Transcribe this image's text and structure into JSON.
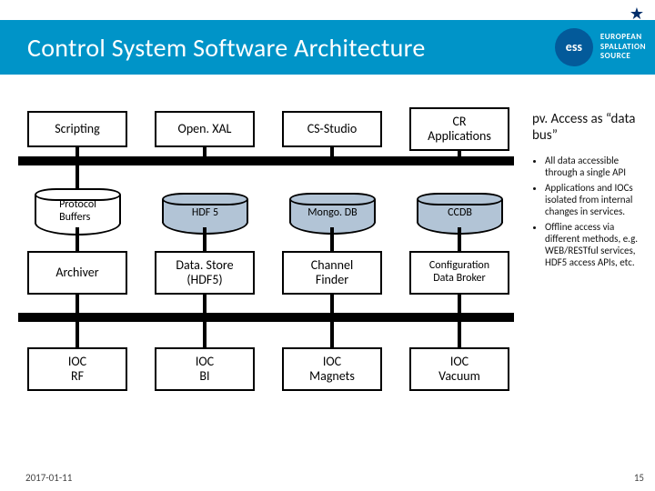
{
  "header": {
    "title": "Control System Software Architecture",
    "brand_line1": "EUROPEAN",
    "brand_line2": "SPALLATION",
    "brand_line3": "SOURCE",
    "brand_mono": "ess"
  },
  "rows": {
    "r1": {
      "c1": "Scripting",
      "c2": "Open. XAL",
      "c3": "CS-Studio",
      "c4": "CR\nApplications"
    },
    "r2": {
      "c1": "Protocol\nBuffers",
      "c2": "HDF 5",
      "c3": "Mongo. DB",
      "c4": "CCDB"
    },
    "r3": {
      "c1": "Archiver",
      "c2": "Data. Store\n(HDF5)",
      "c3": "Channel\nFinder",
      "c4": "Configuration\nData Broker"
    },
    "r4": {
      "c1": "IOC\nRF",
      "c2": "IOC\nBI",
      "c3": "IOC\nMagnets",
      "c4": "IOC\nVacuum"
    }
  },
  "sidebar": {
    "title": "pv. Access as “data bus”",
    "bullets": [
      "All data accessible through a single API",
      "Applications and IOCs isolated from internal changes in services.",
      "Offline access via different methods, e.g. WEB/RESTful services, HDF5 access APIs, etc."
    ]
  },
  "footer": {
    "date": "2017-01-11",
    "page": "15"
  }
}
